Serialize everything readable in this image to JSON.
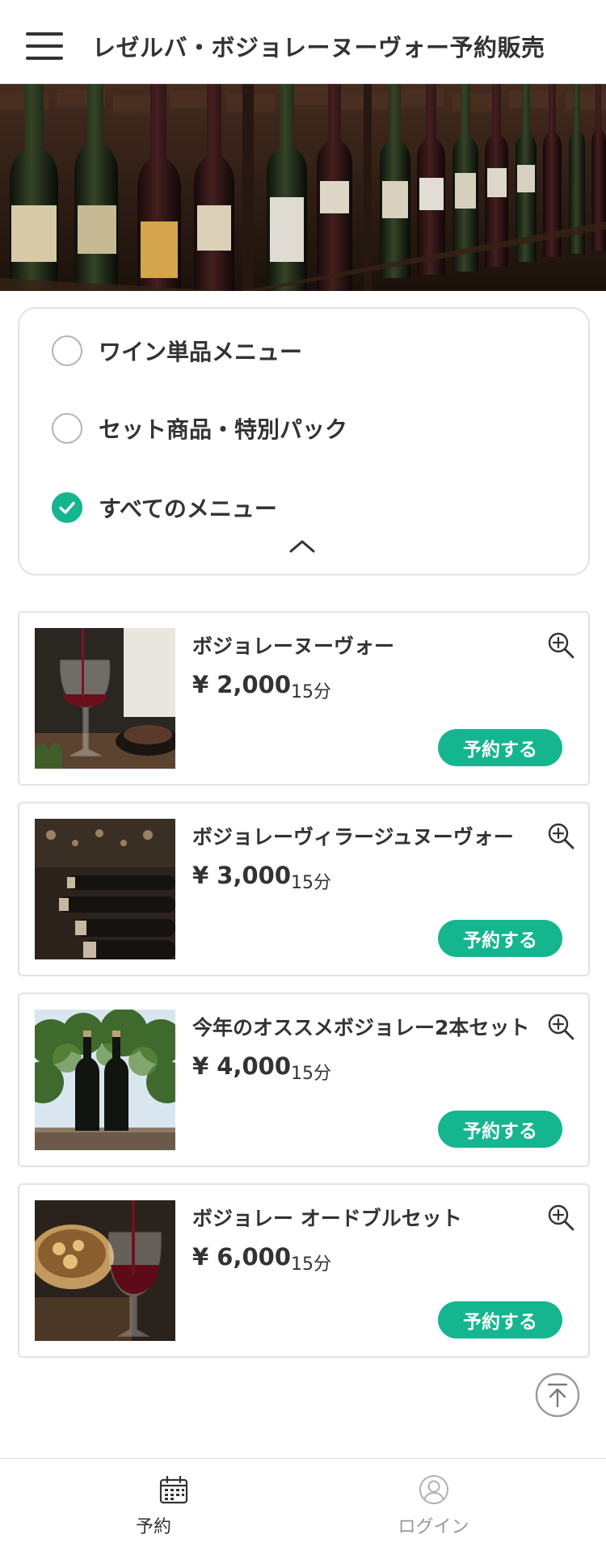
{
  "header": {
    "menu_icon": "hamburger-menu-icon",
    "title": "レゼルバ・ボジョレーヌーヴォー予約販売"
  },
  "filter": {
    "options": [
      {
        "label": "ワイン単品メニュー",
        "selected": false
      },
      {
        "label": "セット商品・特別パック",
        "selected": false
      },
      {
        "label": "すべてのメニュー",
        "selected": true
      }
    ],
    "collapse_icon": "chevron-up-icon"
  },
  "products": [
    {
      "name": "ボジョレーヌーヴォー",
      "price": "¥ 2,000",
      "duration": "15分",
      "button": "予約する",
      "thumb": "wine-glass-pour"
    },
    {
      "name": "ボジョレーヴィラージュヌーヴォー",
      "price": "¥ 3,000",
      "duration": "15分",
      "button": "予約する",
      "thumb": "wine-bottle-rack"
    },
    {
      "name": "今年のオススメボジョレー2本セット",
      "price": "¥ 4,000",
      "duration": "15分",
      "button": "予約する",
      "thumb": "two-bottles-vineyard"
    },
    {
      "name": "ボジョレー オードブルセット",
      "price": "¥ 6,000",
      "duration": "15分",
      "button": "予約する",
      "thumb": "hors-doeuvre-wine"
    }
  ],
  "bottom_nav": [
    {
      "label": "予約",
      "icon": "calendar-icon",
      "active": true
    },
    {
      "label": "ログイン",
      "icon": "user-icon",
      "active": false
    }
  ],
  "colors": {
    "accent": "#15b58f",
    "text": "#333333",
    "inactive": "#999999",
    "border": "#e2e2e2"
  }
}
